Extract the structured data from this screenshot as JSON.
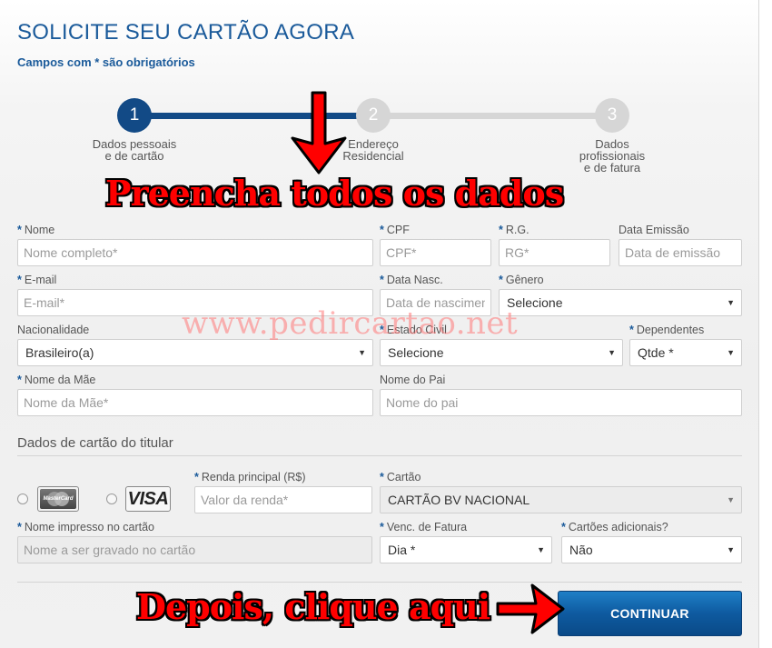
{
  "header": {
    "title": "SOLICITE SEU CARTÃO AGORA",
    "subtitle": "Campos com * são obrigatórios"
  },
  "stepper": {
    "steps": [
      {
        "number": "1",
        "label_lines": [
          "Dados pessoais",
          "e de cartão"
        ],
        "active": true
      },
      {
        "number": "2",
        "label_lines": [
          "Endereço",
          "Residencial"
        ],
        "active": false
      },
      {
        "number": "3",
        "label_lines": [
          "Dados",
          "profissionais",
          "e de fatura"
        ],
        "active": false
      }
    ]
  },
  "overlays": {
    "fill_caption": "Preencha todos os dados",
    "watermark": "www.pedircartao.net",
    "click_caption": "Depois, clique aqui"
  },
  "required_mark": "*",
  "form": {
    "nome": {
      "label": "Nome",
      "placeholder": "Nome completo*"
    },
    "cpf": {
      "label": "CPF",
      "placeholder": "CPF*"
    },
    "rg": {
      "label": "R.G.",
      "placeholder": "RG*"
    },
    "data_emissao": {
      "label": "Data Emissão",
      "placeholder": "Data de emissão"
    },
    "email": {
      "label": "E-mail",
      "placeholder": "E-mail*"
    },
    "data_nasc": {
      "label": "Data Nasc.",
      "placeholder": "Data de nascimento"
    },
    "genero": {
      "label": "Gênero",
      "value": "Selecione"
    },
    "nacionalidade": {
      "label": "Nacionalidade",
      "value": "Brasileiro(a)"
    },
    "estado_civil": {
      "label": "Estado Civil",
      "value": "Selecione"
    },
    "dependentes": {
      "label": "Dependentes",
      "value": "Qtde *"
    },
    "nome_mae": {
      "label": "Nome da Mãe",
      "placeholder": "Nome da Mãe*"
    },
    "nome_pai": {
      "label": "Nome do Pai",
      "placeholder": "Nome do pai"
    }
  },
  "card_section": {
    "title": "Dados de cartão do titular",
    "brands": [
      "MasterCard",
      "VISA"
    ],
    "renda": {
      "label": "Renda principal (R$)",
      "placeholder": "Valor da renda*"
    },
    "cartao": {
      "label": "Cartão",
      "value": "CARTÃO BV NACIONAL"
    },
    "nome_impresso": {
      "label": "Nome impresso no cartão",
      "placeholder": "Nome a ser gravado no cartão"
    },
    "venc_fatura": {
      "label": "Venc. de Fatura",
      "value": "Dia *"
    },
    "cartoes_adicionais": {
      "label": "Cartões adicionais?",
      "value": "Não"
    }
  },
  "actions": {
    "continue_label": "CONTINUAR"
  },
  "colors": {
    "accent": "#1a5a9a",
    "step_active": "#124a86",
    "step_inactive": "#d6d6d6",
    "caption_red": "#ff0000",
    "button": "#0e5aa0"
  }
}
